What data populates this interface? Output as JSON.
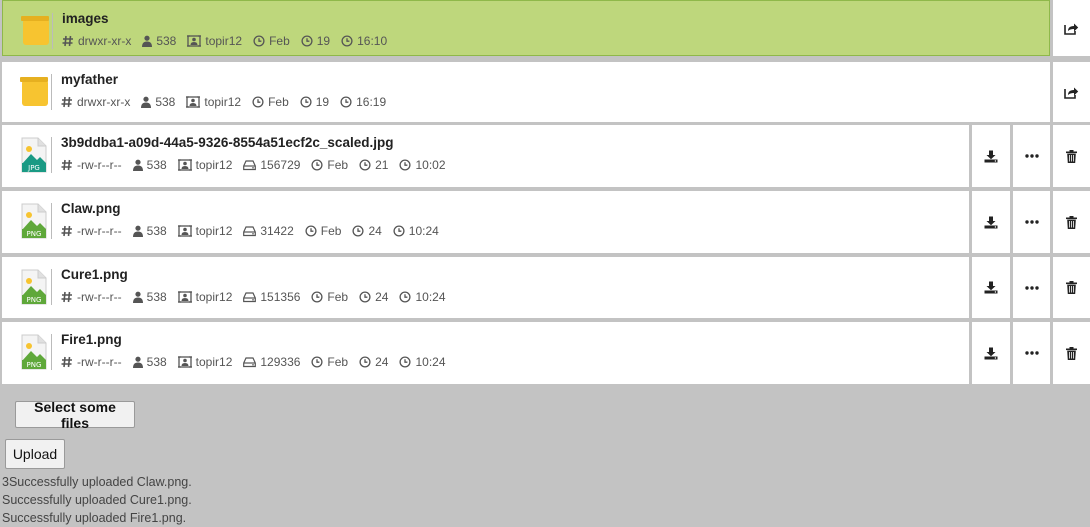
{
  "files": [
    {
      "name": "images",
      "type": "folder",
      "perm": "drwxr-xr-x",
      "uid": "538",
      "owner": "topir12",
      "month": "Feb",
      "day": "19",
      "time": "16:10",
      "active": true
    },
    {
      "name": "myfather",
      "type": "folder",
      "perm": "drwxr-xr-x",
      "uid": "538",
      "owner": "topir12",
      "month": "Feb",
      "day": "19",
      "time": "16:19",
      "active": false
    },
    {
      "name": "3b9ddba1-a09d-44a5-9326-8554a51ecf2c_scaled.jpg",
      "type": "JPG",
      "perm": "-rw-r--r--",
      "uid": "538",
      "owner": "topir12",
      "size": "156729",
      "month": "Feb",
      "day": "21",
      "time": "10:02",
      "active": false
    },
    {
      "name": "Claw.png",
      "type": "PNG",
      "perm": "-rw-r--r--",
      "uid": "538",
      "owner": "topir12",
      "size": "31422",
      "month": "Feb",
      "day": "24",
      "time": "10:24",
      "active": false
    },
    {
      "name": "Cure1.png",
      "type": "PNG",
      "perm": "-rw-r--r--",
      "uid": "538",
      "owner": "topir12",
      "size": "151356",
      "month": "Feb",
      "day": "24",
      "time": "10:24",
      "active": false
    },
    {
      "name": "Fire1.png",
      "type": "PNG",
      "perm": "-rw-r--r--",
      "uid": "538",
      "owner": "topir12",
      "size": "129336",
      "month": "Feb",
      "day": "24",
      "time": "10:24",
      "active": false
    }
  ],
  "colors": {
    "active": "#bed77c",
    "folder": "#f7c430",
    "jpg": "#1a9a84",
    "png": "#5fa83a"
  },
  "select_files_label": "Select some files",
  "upload_label": "Upload",
  "log": [
    "3Successfully uploaded Claw.png.",
    "Successfully uploaded Cure1.png.",
    "Successfully uploaded Fire1.png."
  ]
}
